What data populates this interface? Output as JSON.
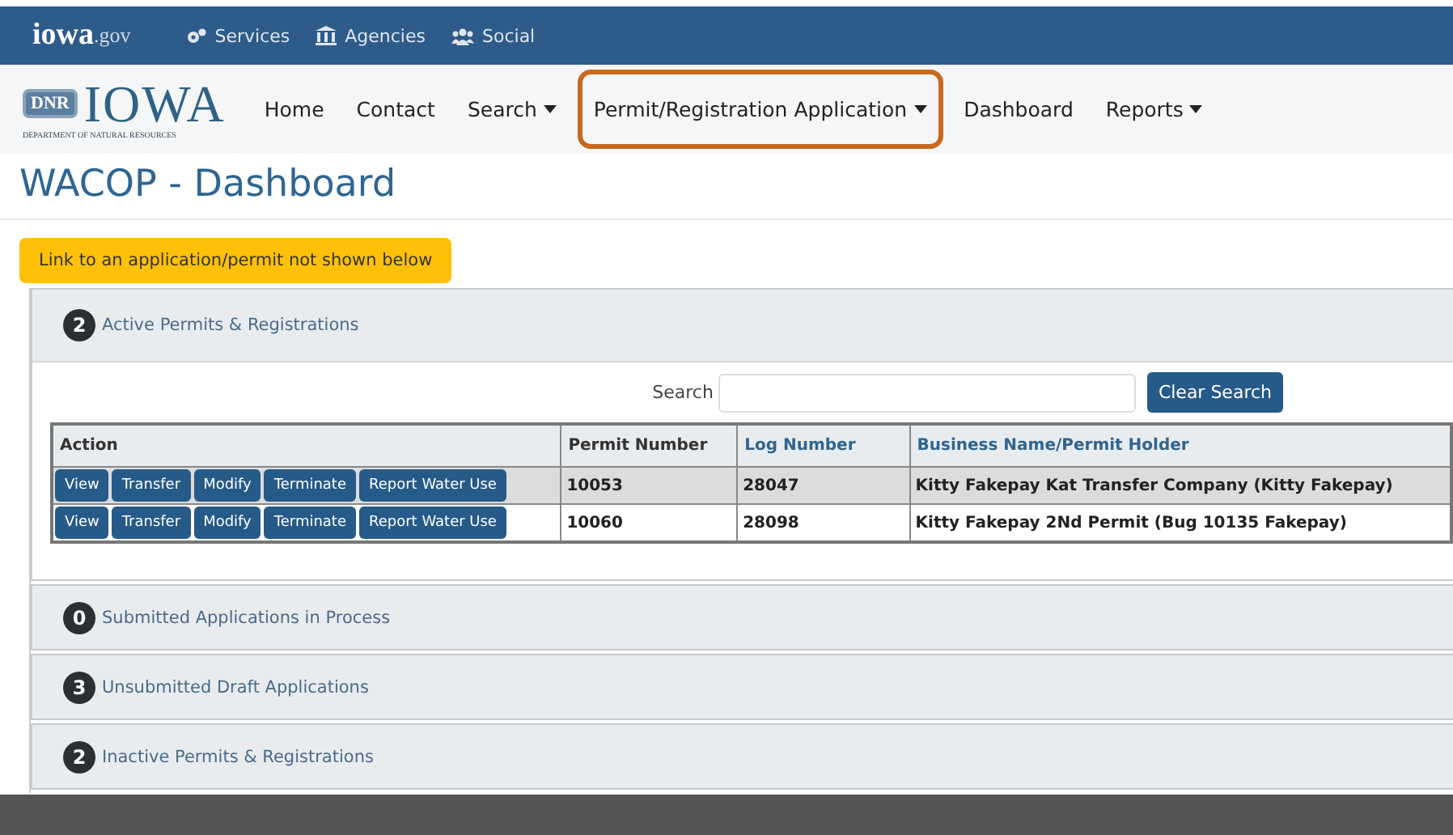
{
  "top_bar": {
    "logo": {
      "main": "iowa",
      "suffix": ".gov"
    },
    "links": [
      {
        "kind": "services",
        "label": "Services"
      },
      {
        "kind": "agencies",
        "label": "Agencies"
      },
      {
        "kind": "social",
        "label": "Social"
      }
    ]
  },
  "nav": {
    "logo": {
      "badge": "DNR",
      "name": "IOWA",
      "subtitle": "DEPARTMENT OF NATURAL RESOURCES"
    },
    "items": [
      {
        "label": "Home",
        "dropdown": false,
        "highlighted": false
      },
      {
        "label": "Contact",
        "dropdown": false,
        "highlighted": false
      },
      {
        "label": "Search",
        "dropdown": true,
        "highlighted": false
      },
      {
        "label": "Permit/Registration Application",
        "dropdown": true,
        "highlighted": true
      },
      {
        "label": "Dashboard",
        "dropdown": false,
        "highlighted": false
      },
      {
        "label": "Reports",
        "dropdown": true,
        "highlighted": false
      }
    ]
  },
  "page_title": "WACOP - Dashboard",
  "link_button": "Link to an application/permit not shown below",
  "panels": [
    {
      "count": "2",
      "title": "Active Permits & Registrations",
      "expanded": true
    },
    {
      "count": "0",
      "title": "Submitted Applications in Process",
      "expanded": false
    },
    {
      "count": "3",
      "title": "Unsubmitted Draft Applications",
      "expanded": false
    },
    {
      "count": "2",
      "title": "Inactive Permits & Registrations",
      "expanded": false
    }
  ],
  "search": {
    "label": "Search",
    "button": "Clear Search"
  },
  "table": {
    "columns": [
      {
        "label": "Action",
        "sortable": false
      },
      {
        "label": "Permit Number",
        "sortable": false
      },
      {
        "label": "Log Number",
        "sortable": true
      },
      {
        "label": "Business Name/Permit Holder",
        "sortable": true
      }
    ],
    "rows": [
      {
        "actions": [
          "View",
          "Transfer",
          "Modify",
          "Terminate",
          "Report Water Use"
        ],
        "permit_number": "10053",
        "log_number": "28047",
        "business": "Kitty Fakepay Kat Transfer Company (Kitty Fakepay)",
        "selected": true
      },
      {
        "actions": [
          "View",
          "Transfer",
          "Modify",
          "Terminate",
          "Report Water Use"
        ],
        "permit_number": "10060",
        "log_number": "28098",
        "business": "Kitty Fakepay 2Nd Permit (Bug 10135 Fakepay)",
        "selected": false
      }
    ]
  }
}
